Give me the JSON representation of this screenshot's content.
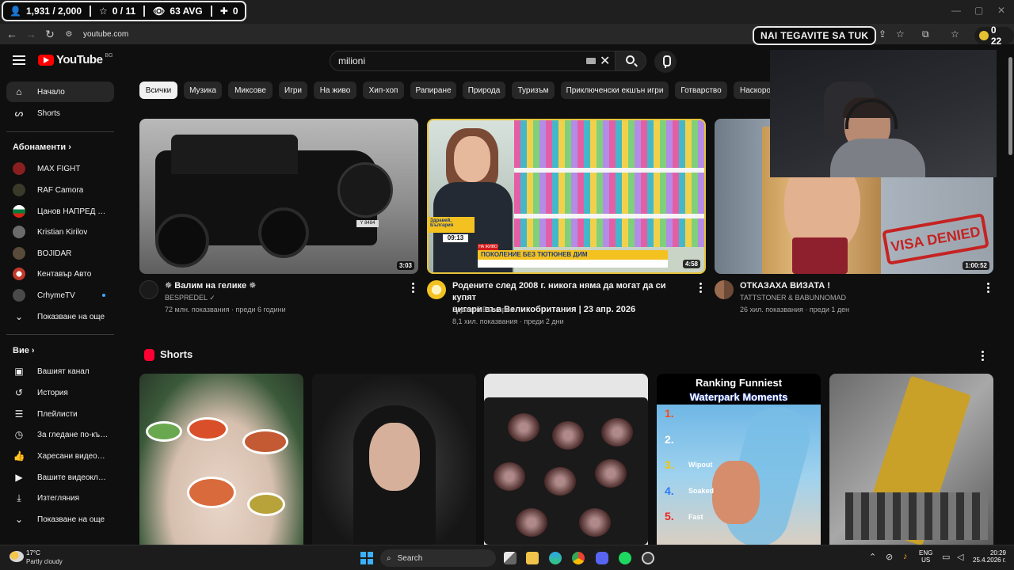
{
  "overlay": {
    "followers": "1,931 / 2,000",
    "stars": "0 / 11",
    "views_avg": "63 AVG",
    "gamepad_count": "0",
    "name_banner": "NAI TEGAVITE SA TUK",
    "counter_value": "0 22"
  },
  "browser": {
    "url": "youtube.com"
  },
  "header": {
    "logo_text": "YouTube",
    "country": "BG",
    "search_value": "milioni"
  },
  "sidebar": {
    "main": [
      {
        "label": "Начало",
        "icon": "home-icon"
      },
      {
        "label": "Shorts",
        "icon": "shorts-icon"
      }
    ],
    "subscriptions_title": "Абонаменти",
    "subscriptions": [
      {
        "label": "MAX FIGHT",
        "color": "#8a1f1f"
      },
      {
        "label": "RAF Camora",
        "color": "#3a3a2a"
      },
      {
        "label": "Цанов НАПРЕД и ...",
        "color": "#3b4fa8"
      },
      {
        "label": "Kristian Kirilov",
        "color": "#6b6b6b"
      },
      {
        "label": "BOJIDAR",
        "color": "#5a4a3a"
      },
      {
        "label": "Кентавър Авто",
        "color": "#c0392b"
      },
      {
        "label": "CrhymeTV",
        "color": "#4a4a4a"
      }
    ],
    "show_more": "Показване на още",
    "you_title": "Вие",
    "you": [
      {
        "label": "Вашият канал",
        "icon": "your-channel-icon"
      },
      {
        "label": "История",
        "icon": "history-icon"
      },
      {
        "label": "Плейлисти",
        "icon": "playlists-icon"
      },
      {
        "label": "За гледане по-къс...",
        "icon": "watch-later-icon"
      },
      {
        "label": "Харесани видеокл...",
        "icon": "liked-videos-icon"
      },
      {
        "label": "Вашите видеокли...",
        "icon": "your-videos-icon"
      },
      {
        "label": "Изтегляния",
        "icon": "downloads-icon"
      },
      {
        "label": "Показване на още",
        "icon": "chevron-down-icon"
      }
    ]
  },
  "chips": [
    "Всички",
    "Музика",
    "Миксове",
    "Игри",
    "На живо",
    "Хип-хоп",
    "Рапиране",
    "Природа",
    "Туризъм",
    "Приключенски екшън игри",
    "Готварство",
    "Наскоро"
  ],
  "videos": [
    {
      "title": "✵ Валим на гелике ✵",
      "title2": "",
      "channel": "BESPREDEL",
      "meta": "72 млн. показвания · преди 6 години",
      "duration": "3:03"
    },
    {
      "title": "Родените след 2008 г. никога няма да могат да си купят",
      "title2": "цигари във Великобритания | 23 апр. 2026",
      "channel": "Здравей България",
      "meta": "8,1 хил. показвания · преди 2 дни",
      "duration": "4:58"
    },
    {
      "title": "ОТКАЗАХА ВИЗАТА !",
      "title2": "",
      "channel": "TATTSTONER & BABUNNOMAD",
      "meta": "26 хил. показвания · преди 1 ден",
      "duration": "1:00:52"
    }
  ],
  "thumb_text": {
    "news_badge": "Здравей, България",
    "news_time": "09:13",
    "news_live": "НА ЖИВО",
    "news_headline": "ПОКОЛЕНИЕ БЕЗ ТЮТЮНЕВ ДИМ",
    "plate": "Y 8484",
    "visa_stamp": "VISA DENIED",
    "short_ranking_1": "Ranking Funniest",
    "short_ranking_2": "Waterpark Moments",
    "short_rank_1": "1.",
    "short_rank_2": "2.",
    "short_rank_3": "3.",
    "short_rank_4": "4.",
    "short_rank_5": "5.",
    "short_wipeout": "Wipout",
    "short_soaked": "Soaked",
    "short_fast": "Fast"
  },
  "shorts_title": "Shorts",
  "taskbar": {
    "temp": "17°C",
    "weather": "Partly cloudy",
    "search": "Search",
    "lang1": "ENG",
    "lang2": "US",
    "time": "20:29",
    "date": "25.4.2026 г."
  }
}
